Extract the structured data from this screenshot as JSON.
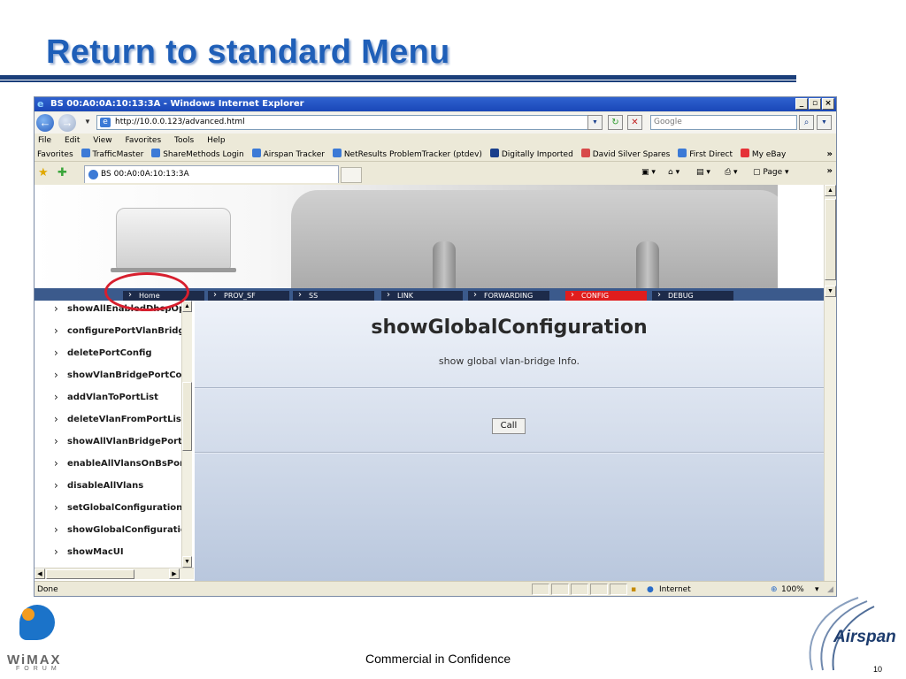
{
  "slide": {
    "title": "Return to standard Menu",
    "footer": "Commercial in Confidence",
    "page_number": "10"
  },
  "logos": {
    "left": {
      "brand": "WiMAX",
      "sub": "FORUM"
    },
    "right": {
      "brand": "Airspan"
    }
  },
  "colors": {
    "title": "#1f5fb8",
    "rule": "#1b3f7a",
    "nav_active": "#e01d1d",
    "nav_item": "#1d2b4a",
    "highlight_circle": "#d71f2e"
  },
  "browser": {
    "window_title": "BS 00:A0:0A:10:13:3A - Windows Internet Explorer",
    "address": "http://10.0.0.123/advanced.html",
    "search_placeholder": "Google",
    "menu": [
      "File",
      "Edit",
      "View",
      "Favorites",
      "Tools",
      "Help"
    ],
    "favorites_label": "Favorites",
    "favorites": [
      "TrafficMaster",
      "ShareMethods Login",
      "Airspan Tracker",
      "NetResults ProblemTracker (ptdev)",
      "Digitally Imported",
      "David Silver Spares",
      "First Direct",
      "My eBay"
    ],
    "tab_title": "BS 00:A0:0A:10:13:3A",
    "page_menu": "Page",
    "status_text": "Done",
    "zone": "Internet",
    "zoom": "100%"
  },
  "app": {
    "top_nav": [
      "Home",
      "PROV_SF",
      "SS",
      "LINK",
      "FORWARDING",
      "CONFIG",
      "DEBUG"
    ],
    "active_nav": "CONFIG",
    "side_items": [
      "showAllEnabledDhcpOp",
      "configurePortVlanBridge",
      "deletePortConfig",
      "showVlanBridgePortConfig",
      "addVlanToPortList",
      "deleteVlanFromPortList",
      "showAllVlanBridgePorts",
      "enableAllVlansOnBsPort",
      "disableAllVlans",
      "setGlobalConfiguration",
      "showGlobalConfiguration",
      "showMacUI"
    ],
    "panel": {
      "title": "showGlobalConfiguration",
      "subtitle": "show global vlan-bridge Info.",
      "call_label": "Call"
    }
  }
}
